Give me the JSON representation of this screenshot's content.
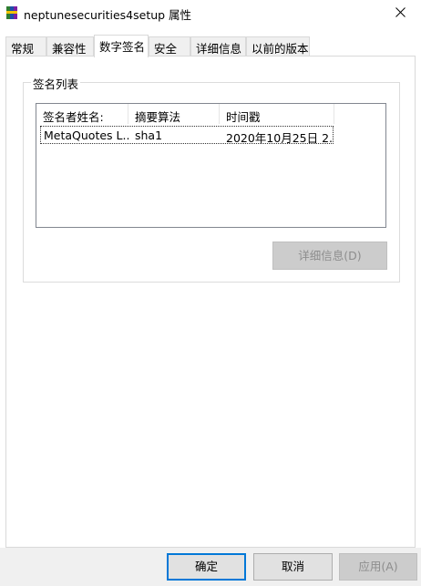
{
  "window": {
    "title": "neptunesecurities4setup 属性",
    "app_icon": "winrar-setup-icon",
    "close_icon": "close-icon"
  },
  "tabs": [
    {
      "label": "常规",
      "active": false
    },
    {
      "label": "兼容性",
      "active": false
    },
    {
      "label": "数字签名",
      "active": true
    },
    {
      "label": "安全",
      "active": false
    },
    {
      "label": "详细信息",
      "active": false
    },
    {
      "label": "以前的版本",
      "active": false
    }
  ],
  "signature_list": {
    "group_label": "签名列表",
    "columns": [
      "签名者姓名:",
      "摘要算法",
      "时间戳"
    ],
    "rows": [
      {
        "name": "MetaQuotes L...",
        "algorithm": "sha1",
        "timestamp": "2020年10月25日 2..."
      }
    ],
    "details_button": "详细信息(D)"
  },
  "footer": {
    "ok": "确定",
    "cancel": "取消",
    "apply": "应用(A)"
  },
  "colors": {
    "accent": "#0078d7",
    "disabled_text": "#8d8d8d",
    "footer_bg": "#f0f0f0"
  }
}
